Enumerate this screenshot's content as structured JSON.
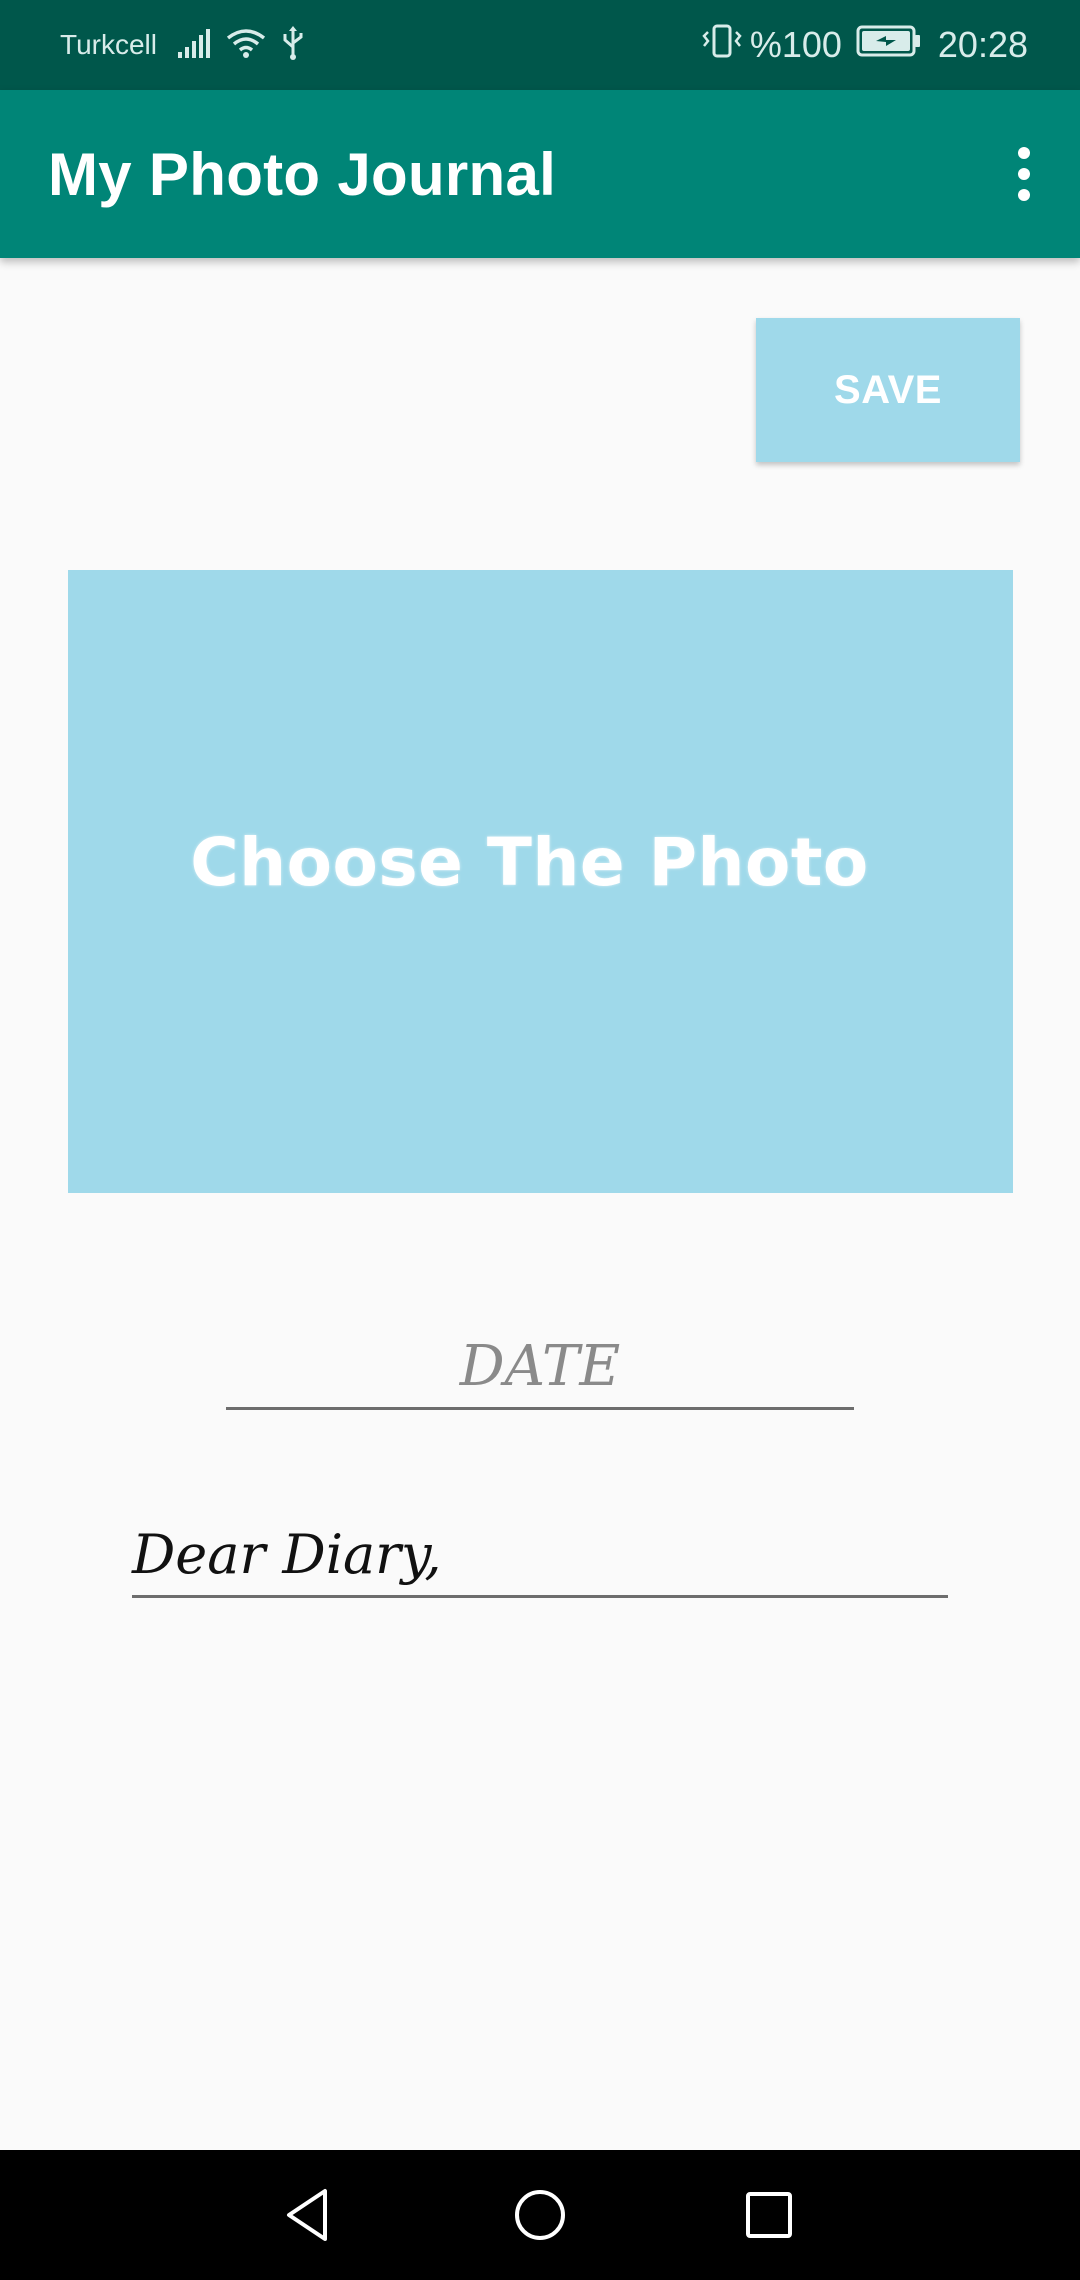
{
  "status_bar": {
    "carrier": "Turkcell",
    "battery_percent": "%100",
    "time": "20:28",
    "icons": [
      "signal-icon",
      "wifi-icon",
      "usb-icon",
      "vibrate-icon",
      "battery-charging-icon"
    ]
  },
  "app_bar": {
    "title": "My Photo Journal",
    "menu_icon": "overflow-menu-icon"
  },
  "toolbar": {
    "save_label": "SAVE"
  },
  "photo_picker": {
    "label": "Choose The Photo"
  },
  "date_field": {
    "placeholder": "DATE",
    "value": ""
  },
  "diary_field": {
    "value": "Dear Diary,"
  },
  "nav_bar": {
    "icons": [
      "back-icon",
      "home-icon",
      "recents-icon"
    ]
  },
  "colors": {
    "status_bar": "#00574b",
    "app_bar": "#008577",
    "accent_light_blue": "#9fd9ea",
    "background": "#fafafa",
    "nav_bar": "#000000"
  }
}
